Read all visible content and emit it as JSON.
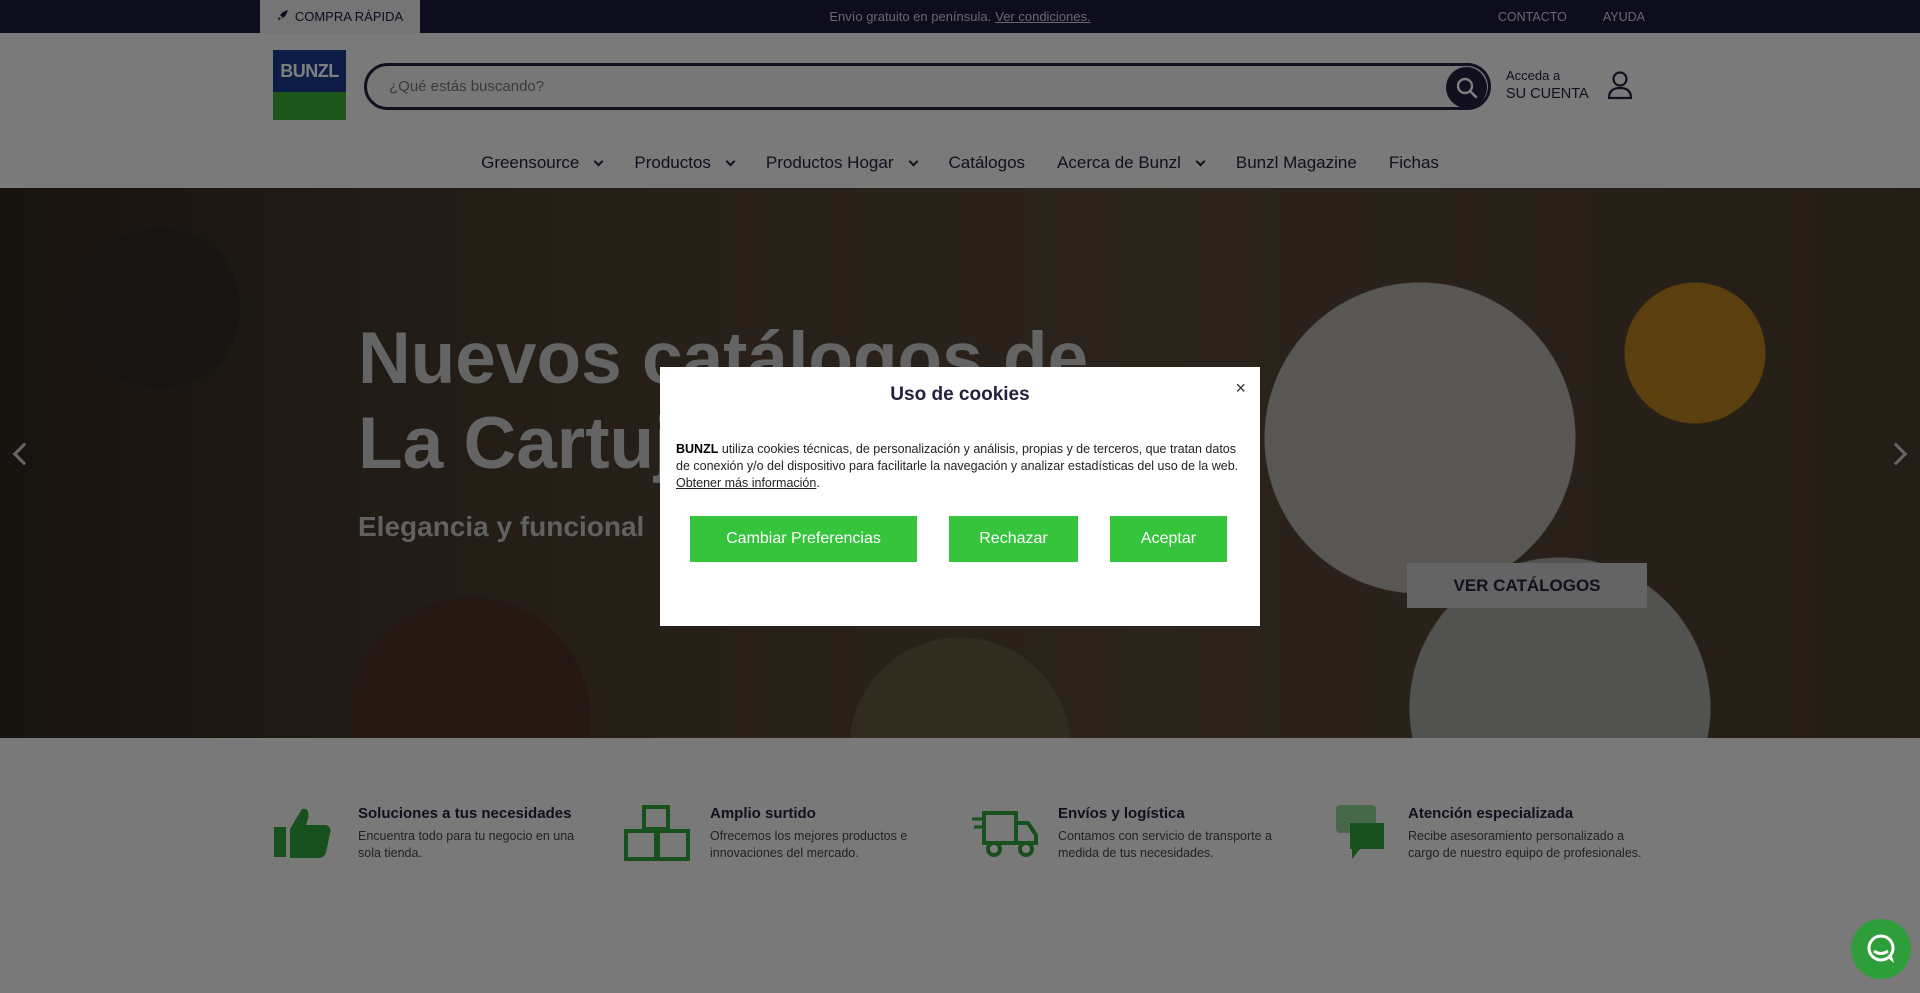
{
  "topbar": {
    "quick_buy": "COMPRA RÁPIDA",
    "shipping_text": "Envío gratuito en península.",
    "shipping_link": "Ver condiciones.",
    "links": [
      "CONTACTO",
      "AYUDA"
    ]
  },
  "header": {
    "logo_text": "BUNZL",
    "search_placeholder": "¿Qué estás buscando?",
    "account_line1": "Acceda a",
    "account_line2": "SU CUENTA"
  },
  "nav": [
    {
      "label": "Greensource",
      "dropdown": true
    },
    {
      "label": "Productos",
      "dropdown": true
    },
    {
      "label": "Productos Hogar",
      "dropdown": true
    },
    {
      "label": "Catálogos",
      "dropdown": false
    },
    {
      "label": "Acerca de Bunzl",
      "dropdown": true
    },
    {
      "label": "Bunzl Magazine",
      "dropdown": false
    },
    {
      "label": "Fichas",
      "dropdown": false
    }
  ],
  "hero": {
    "title_line1": "Nuevos catálogos de",
    "title_line2": "La Cartuja",
    "subtitle": "Elegancia y funcional",
    "cta": "VER CATÁLOGOS"
  },
  "features": [
    {
      "icon": "thumbs-up-icon",
      "title": "Soluciones a tus necesidades",
      "desc": "Encuentra todo para tu negocio en una sola tienda."
    },
    {
      "icon": "boxes-icon",
      "title": "Amplio surtido",
      "desc": "Ofrecemos los mejores productos e innovaciones del mercado."
    },
    {
      "icon": "truck-icon",
      "title": "Envíos y logística",
      "desc": "Contamos con servicio de transporte a medida de tus necesidades."
    },
    {
      "icon": "chat-icon",
      "title": "Atención especializada",
      "desc": "Recibe asesoramiento personalizado a cargo de nuestro equipo de profesionales."
    }
  ],
  "cookie_modal": {
    "title": "Uso de cookies",
    "close": "×",
    "brand": "BUNZL",
    "text": " utiliza cookies técnicas, de personalización y análisis, propias y de terceros, que tratan datos de conexión y/o del dispositivo para facilitarle la navegación y analizar estadísticas del uso de la web. ",
    "more_link": "Obtener más información",
    "buttons": {
      "preferences": "Cambiar Preferencias",
      "reject": "Rechazar",
      "accept": "Aceptar"
    }
  },
  "colors": {
    "navy": "#24213f",
    "green": "#36c43d",
    "brand_blue": "#1a3a8c"
  }
}
